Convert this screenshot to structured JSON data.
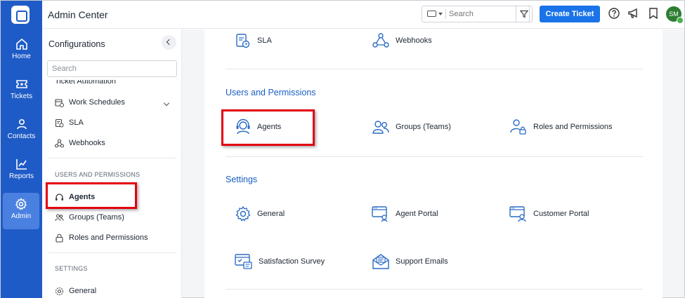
{
  "rail": {
    "items": [
      {
        "label": "Home",
        "icon": "home-icon"
      },
      {
        "label": "Tickets",
        "icon": "ticket-icon"
      },
      {
        "label": "Contacts",
        "icon": "contact-icon"
      },
      {
        "label": "Reports",
        "icon": "chart-icon"
      },
      {
        "label": "Admin",
        "icon": "gear-icon",
        "active": true
      }
    ]
  },
  "header": {
    "title": "Admin Center",
    "search_placeholder": "Search",
    "create_ticket_label": "Create Ticket",
    "avatar_initials": "SM"
  },
  "sidebar": {
    "title": "Configurations",
    "search_placeholder": "Search",
    "cut_item": "Ticket Automation",
    "items_top": [
      {
        "label": "Work Schedules",
        "icon": "calendar-clock-icon"
      },
      {
        "label": "SLA",
        "icon": "sla-icon"
      },
      {
        "label": "Webhooks",
        "icon": "webhook-icon"
      }
    ],
    "section_users": "USERS AND PERMISSIONS",
    "items_users": [
      {
        "label": "Agents",
        "icon": "headset-icon"
      },
      {
        "label": "Groups (Teams)",
        "icon": "group-icon"
      },
      {
        "label": "Roles and Permissions",
        "icon": "lock-icon"
      }
    ],
    "section_settings": "SETTINGS",
    "items_settings": [
      {
        "label": "General",
        "icon": "gear-icon"
      }
    ]
  },
  "main": {
    "top_tiles": [
      {
        "label": "SLA",
        "icon": "sla-icon"
      },
      {
        "label": "Webhooks",
        "icon": "webhook-icon"
      }
    ],
    "users_section": {
      "title": "Users and Permissions",
      "tiles": [
        {
          "label": "Agents",
          "icon": "headset-icon"
        },
        {
          "label": "Groups (Teams)",
          "icon": "group-icon"
        },
        {
          "label": "Roles and Permissions",
          "icon": "user-lock-icon"
        }
      ]
    },
    "settings_section": {
      "title": "Settings",
      "tiles": [
        {
          "label": "General",
          "icon": "gear-icon"
        },
        {
          "label": "Agent Portal",
          "icon": "agent-portal-icon"
        },
        {
          "label": "Customer Portal",
          "icon": "customer-portal-icon"
        },
        {
          "label": "Satisfaction Survey",
          "icon": "survey-icon"
        },
        {
          "label": "Support Emails",
          "icon": "envelope-icon"
        }
      ]
    }
  },
  "colors": {
    "rail": "#1f5bc6",
    "accent": "#1a73e8",
    "section_title": "#1a5fc4",
    "highlight": "#e4000f"
  }
}
